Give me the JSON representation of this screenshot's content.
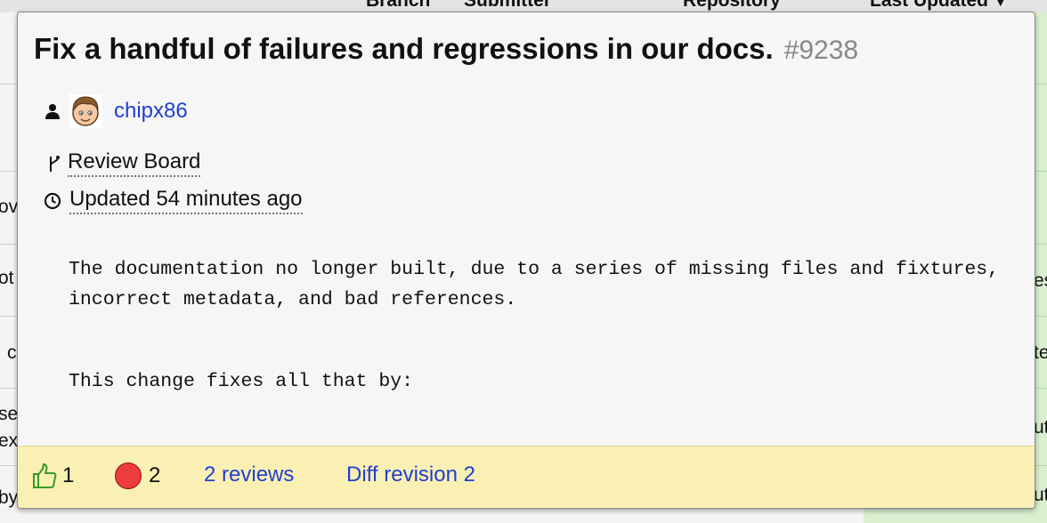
{
  "background": {
    "columns": [
      "Branch",
      "Submitter",
      "Repository",
      "Last Updated"
    ],
    "left_fragments": [
      "ov",
      "ot",
      "c",
      "se",
      "ex",
      "by"
    ],
    "right_fragments": [
      "es",
      "te",
      "ut",
      "ut"
    ]
  },
  "popup": {
    "title": "Fix a handful of failures and regressions in our docs.",
    "review_request_id": "#9238",
    "submitter": "chipx86",
    "repository": "Review Board",
    "updated": "Updated 54 minutes ago",
    "description": [
      "The documentation no longer built, due to a series of missing files and fixtures, incorrect metadata, and bad references.",
      "This change fixes all that by:"
    ],
    "footer": {
      "ship_it_count": "1",
      "issue_count": "2",
      "reviews_link": "2 reviews",
      "diff_link": "Diff revision 2"
    }
  },
  "icons": {
    "submitter": "user-icon",
    "repository": "branch-icon",
    "updated": "clock-icon",
    "ship_it": "thumbs-up-icon",
    "issues": "issue-circle-icon"
  },
  "colors": {
    "link": "#1f3fd0",
    "footer_bg": "#fbf0b4",
    "issue": "#ee3c3c",
    "ship_it": "#3a9a23"
  }
}
